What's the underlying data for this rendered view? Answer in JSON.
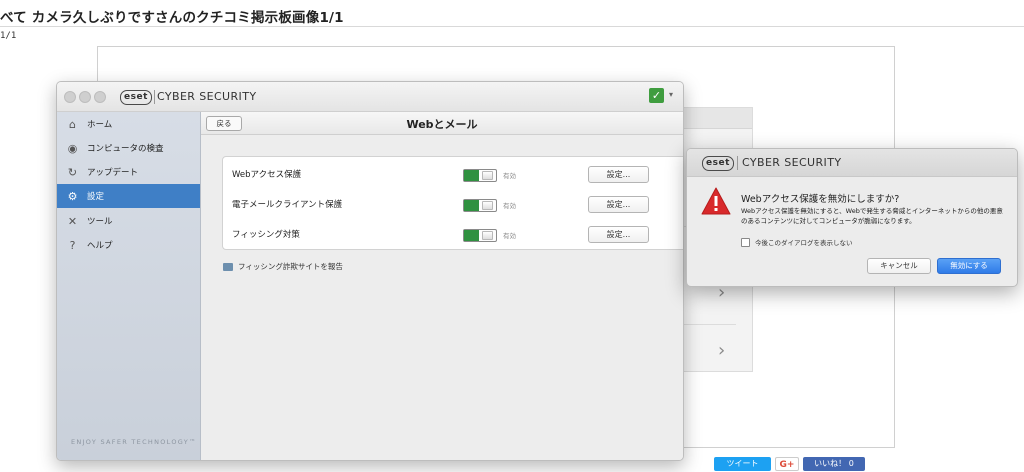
{
  "page": {
    "title": "べて カメラ久しぶりですさんのクチコミ掲示板画像1/1",
    "counter": "1/1"
  },
  "app": {
    "logo": "eset",
    "name": "CYBER SECURITY",
    "status_icon": "check-icon"
  },
  "sidebar": {
    "items": [
      {
        "label": "ホーム",
        "icon": "home-icon"
      },
      {
        "label": "コンピュータの検査",
        "icon": "scan-icon"
      },
      {
        "label": "アップデート",
        "icon": "update-icon"
      },
      {
        "label": "設定",
        "icon": "gear-icon",
        "active": true
      },
      {
        "label": "ツール",
        "icon": "tools-icon"
      },
      {
        "label": "ヘルプ",
        "icon": "help-icon"
      }
    ],
    "tagline": "ENJOY SAFER TECHNOLOGY™"
  },
  "content": {
    "back_label": "戻る",
    "title": "Webとメール",
    "rows": [
      {
        "label": "Webアクセス保護",
        "state": "有効",
        "button": "設定..."
      },
      {
        "label": "電子メールクライアント保護",
        "state": "有効",
        "button": "設定..."
      },
      {
        "label": "フィッシング対策",
        "state": "有効",
        "button": "設定..."
      }
    ],
    "report_link": "フィッシング詐欺サイトを報告"
  },
  "dialog": {
    "logo": "eset",
    "app_name": "CYBER SECURITY",
    "title": "Webアクセス保護を無効にしますか?",
    "message": "Webアクセス保護を無効にすると、Webで発生する脅威とインターネットからの他の悪意のあるコンテンツに対してコンピュータが脆弱になります。",
    "checkbox_label": "今後このダイアログを表示しない",
    "cancel_label": "キャンセル",
    "confirm_label": "無効にする"
  },
  "social": {
    "tweet": "ツイート",
    "gplus": "G+",
    "like": "いいね！ 0"
  },
  "colors": {
    "accent_blue": "#3f7fc6",
    "toggle_green": "#2f9140",
    "warning_red": "#d8292b"
  }
}
